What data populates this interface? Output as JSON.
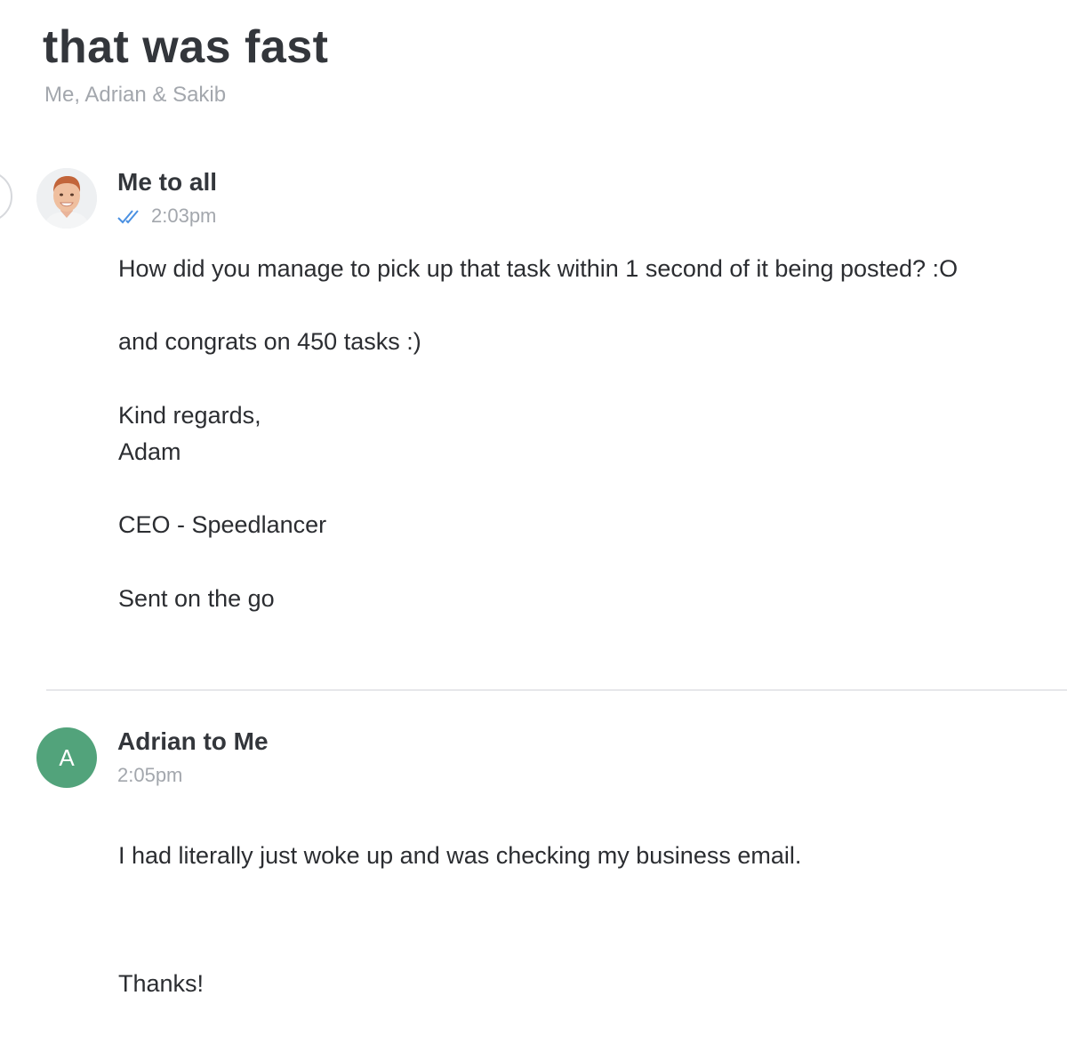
{
  "thread": {
    "title": "that was fast",
    "participants": "Me, Adrian & Sakib"
  },
  "messages": [
    {
      "sender": "Me to all",
      "time": "2:03pm",
      "status_icon": "double-check-icon",
      "avatar": "profile-photo",
      "body": [
        "How did you manage to pick up that task within 1 second of it being posted? :O",
        "and congrats on 450 tasks :)",
        "Kind regards,",
        "Adam",
        "CEO - Speedlancer",
        "Sent on the go"
      ]
    },
    {
      "sender": "Adrian to Me",
      "time": "2:05pm",
      "avatar_letter": "A",
      "body": [
        "I had literally just woke up and was checking my business email.",
        "Thanks!"
      ]
    }
  ],
  "colors": {
    "title": "#33363b",
    "muted": "#a3a7ad",
    "body_text": "#2b2d31",
    "read_check": "#4a90e2",
    "avatar_green": "#52a37b",
    "divider": "#e6e7ea"
  }
}
